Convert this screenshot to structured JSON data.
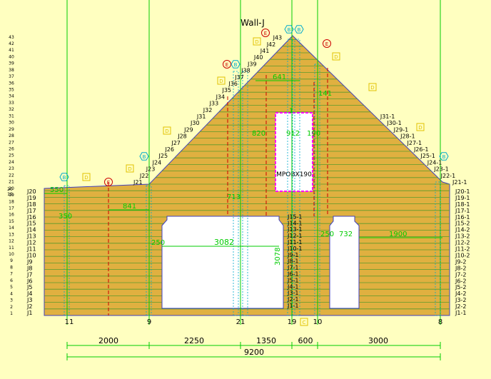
{
  "title": "Wall-J",
  "colors": {
    "background": "#ffffc0",
    "wall_fill": "#e0b040",
    "course_line": "#5a9a2a",
    "grid_line": "#00cc00",
    "dimension": "#00cc00",
    "edge": "#4040c0",
    "opening_fill": "#ffffff",
    "red_marker": "#cc0000",
    "cyan_marker": "#00aacc",
    "yellow_box": "#e0c000",
    "magenta": "#ff00ff",
    "text": "#000000"
  },
  "course_numbers": [
    "1",
    "2",
    "3",
    "4",
    "5",
    "6",
    "7",
    "8",
    "9",
    "10",
    "11",
    "12",
    "13",
    "14",
    "15",
    "16",
    "17",
    "18",
    "19",
    "20",
    "21",
    "22",
    "23",
    "24",
    "25",
    "26",
    "27",
    "28",
    "29",
    "30",
    "31",
    "32",
    "33",
    "34",
    "35",
    "36",
    "37",
    "38",
    "39",
    "40",
    "41",
    "42",
    "43"
  ],
  "left_side_extra": [
    "20",
    "19"
  ],
  "left_labels": [
    "J1",
    "J2",
    "J3",
    "J4",
    "J5",
    "J6",
    "J7",
    "J8",
    "J9",
    "J10",
    "J11",
    "J12",
    "J13",
    "J14",
    "J15",
    "J16",
    "J17",
    "J18",
    "J19",
    "J20"
  ],
  "slope_left_labels": [
    "J21",
    "J22",
    "J23",
    "J24",
    "J25",
    "J26",
    "J27",
    "J28",
    "J29",
    "J30",
    "J31",
    "J32",
    "J33",
    "J34",
    "J35",
    "J36",
    "J37",
    "J38",
    "J39",
    "J40",
    "J41",
    "J42",
    "J43"
  ],
  "right_labels": [
    "J1-1",
    "J2-2",
    "J3-2",
    "J4-2",
    "J5-2",
    "J6-2",
    "J7-2",
    "J8-2",
    "J9-2",
    "J10-2",
    "J11-2",
    "J12-2",
    "J13-2",
    "J14-2",
    "J15-2",
    "J16-1",
    "J17-1",
    "J18-1",
    "J19-1",
    "J20-1"
  ],
  "slope_right_labels": [
    "J21-1",
    "J22-1",
    "J23-1",
    "J24-1",
    "J25-1",
    "J26-1",
    "J27-1",
    "J28-1",
    "J29-1",
    "J30-1",
    "J31-1"
  ],
  "middle_labels": [
    "J1-1",
    "J2-1",
    "J3-1",
    "J4-1",
    "J5-1",
    "J6-1",
    "J7-1",
    "J8-1",
    "J9-1",
    "J10-1",
    "J11-1",
    "J12-1",
    "J13-1",
    "J14-1",
    "J15-1"
  ],
  "gridline_labels": [
    "11",
    "9",
    "21",
    "19",
    "10",
    "8"
  ],
  "opening_label": "MPOBX190",
  "dimensions": {
    "segments": [
      "2000",
      "2250",
      "1350",
      "600",
      "3000"
    ],
    "total": "9200",
    "inner": {
      "d550": "550",
      "d350": "350",
      "d841": "841",
      "d250a": "250",
      "d3082": "3082",
      "d3078": "3078",
      "d250b": "250",
      "d732": "732",
      "d1900": "1900",
      "d641": "641",
      "d141": "141",
      "d820": "820",
      "d912": "912",
      "d190": "190",
      "d713": "713",
      "d1": "1"
    }
  },
  "markers": {
    "e": "E",
    "b": "B",
    "d": "D",
    "c": "C"
  }
}
